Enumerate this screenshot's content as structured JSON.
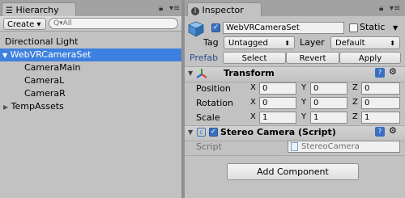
{
  "hierarchy": {
    "tab_label": "Hierarchy",
    "create_label": "Create ▾",
    "search_placeholder": "Q▾All",
    "items": [
      {
        "label": "Directional Light"
      },
      {
        "label": "WebVRCameraSet",
        "expand": "▼"
      },
      {
        "label": "CameraMain"
      },
      {
        "label": "CameraL"
      },
      {
        "label": "CameraR"
      },
      {
        "label": "TempAssets",
        "expand": "▶"
      }
    ]
  },
  "inspector": {
    "tab_label": "Inspector",
    "object_name": "WebVRCameraSet",
    "static_label": "Static",
    "tag_label": "Tag",
    "tag_value": "Untagged",
    "layer_label": "Layer",
    "layer_value": "Default",
    "prefab_label": "Prefab",
    "prefab_buttons": {
      "select": "Select",
      "revert": "Revert",
      "apply": "Apply"
    },
    "transform": {
      "title": "Transform",
      "rows": [
        {
          "label": "Position",
          "x": "0",
          "y": "0",
          "z": "0"
        },
        {
          "label": "Rotation",
          "x": "0",
          "y": "0",
          "z": "0"
        },
        {
          "label": "Scale",
          "x": "1",
          "y": "1",
          "z": "1"
        }
      ],
      "axis": {
        "x": "X",
        "y": "Y",
        "z": "Z"
      }
    },
    "script_component": {
      "title": "Stereo Camera (Script)",
      "script_label": "Script",
      "script_value": "StereoCamera"
    },
    "add_component_label": "Add Component"
  }
}
